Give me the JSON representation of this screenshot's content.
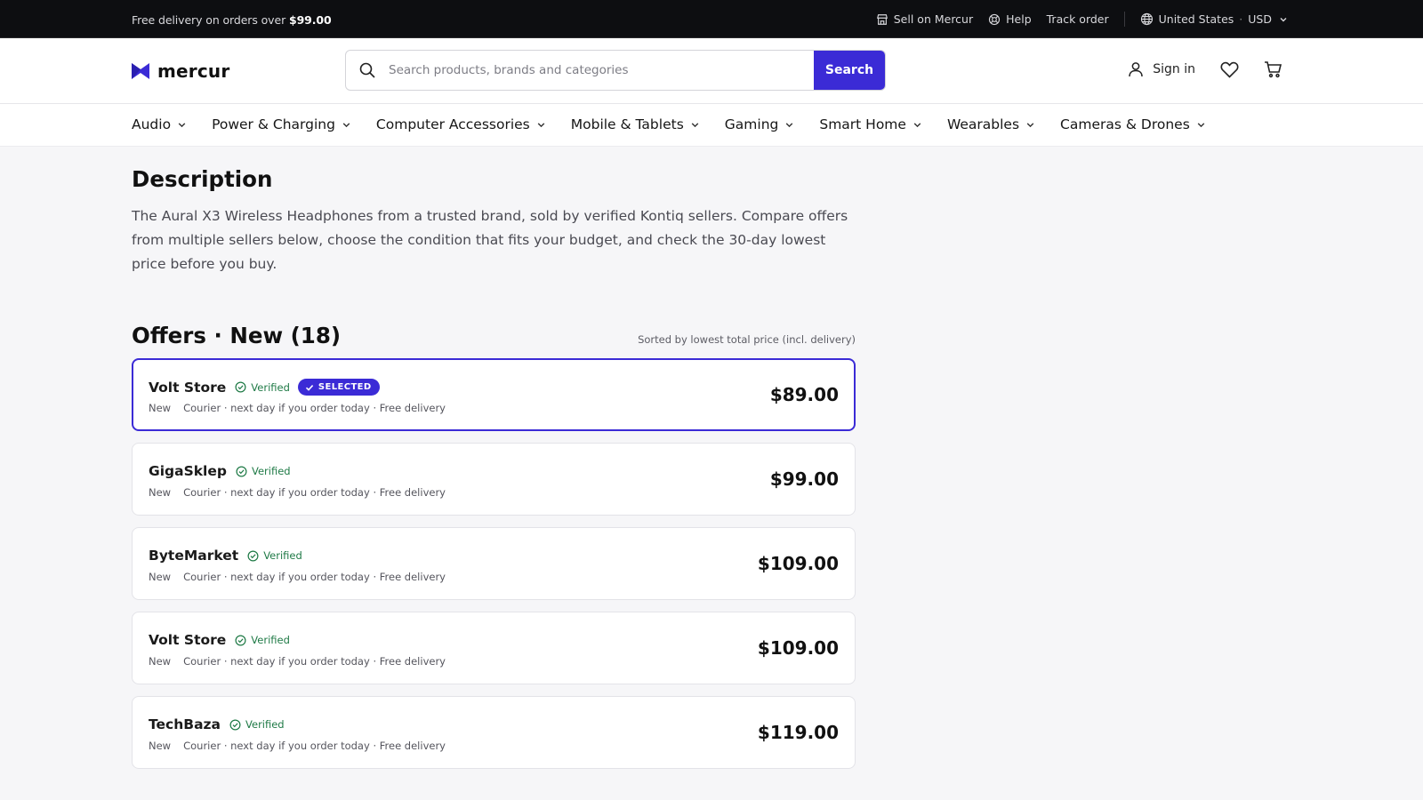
{
  "topbar": {
    "promo_text": "Free delivery on orders over ",
    "promo_amount": "$99.00",
    "sell_label": "Sell on Mercur",
    "help_label": "Help",
    "track_label": "Track order",
    "country": "United States",
    "currency": "USD"
  },
  "header": {
    "brand": "mercur",
    "search_placeholder": "Search products, brands and categories",
    "search_button": "Search",
    "signin_label": "Sign in"
  },
  "nav": {
    "categories": [
      {
        "label": "Audio"
      },
      {
        "label": "Power & Charging"
      },
      {
        "label": "Computer Accessories"
      },
      {
        "label": "Mobile & Tablets"
      },
      {
        "label": "Gaming"
      },
      {
        "label": "Smart Home"
      },
      {
        "label": "Wearables"
      },
      {
        "label": "Cameras & Drones"
      }
    ]
  },
  "description": {
    "title": "Description",
    "text": "The Aural X3 Wireless Headphones from a trusted brand, sold by verified Kontiq sellers. Compare offers from multiple sellers below, choose the condition that fits your budget, and check the 30-day lowest price before you buy."
  },
  "offers": {
    "title": "Offers · New (18)",
    "sort_note": "Sorted by lowest total price (incl. delivery)",
    "verified_label": "Verified",
    "selected_label": "SELECTED",
    "items": [
      {
        "seller": "Volt Store",
        "condition": "New",
        "delivery": "Courier · next day if you order today · Free delivery",
        "price": "$89.00",
        "selected": true
      },
      {
        "seller": "GigaSklep",
        "condition": "New",
        "delivery": "Courier · next day if you order today · Free delivery",
        "price": "$99.00",
        "selected": false
      },
      {
        "seller": "ByteMarket",
        "condition": "New",
        "delivery": "Courier · next day if you order today · Free delivery",
        "price": "$109.00",
        "selected": false
      },
      {
        "seller": "Volt Store",
        "condition": "New",
        "delivery": "Courier · next day if you order today · Free delivery",
        "price": "$109.00",
        "selected": false
      },
      {
        "seller": "TechBaza",
        "condition": "New",
        "delivery": "Courier · next day if you order today · Free delivery",
        "price": "$119.00",
        "selected": false
      }
    ]
  },
  "colors": {
    "accent": "#3b2bd6",
    "verified": "#1f7a46",
    "topbar_bg": "#0d0e11"
  }
}
